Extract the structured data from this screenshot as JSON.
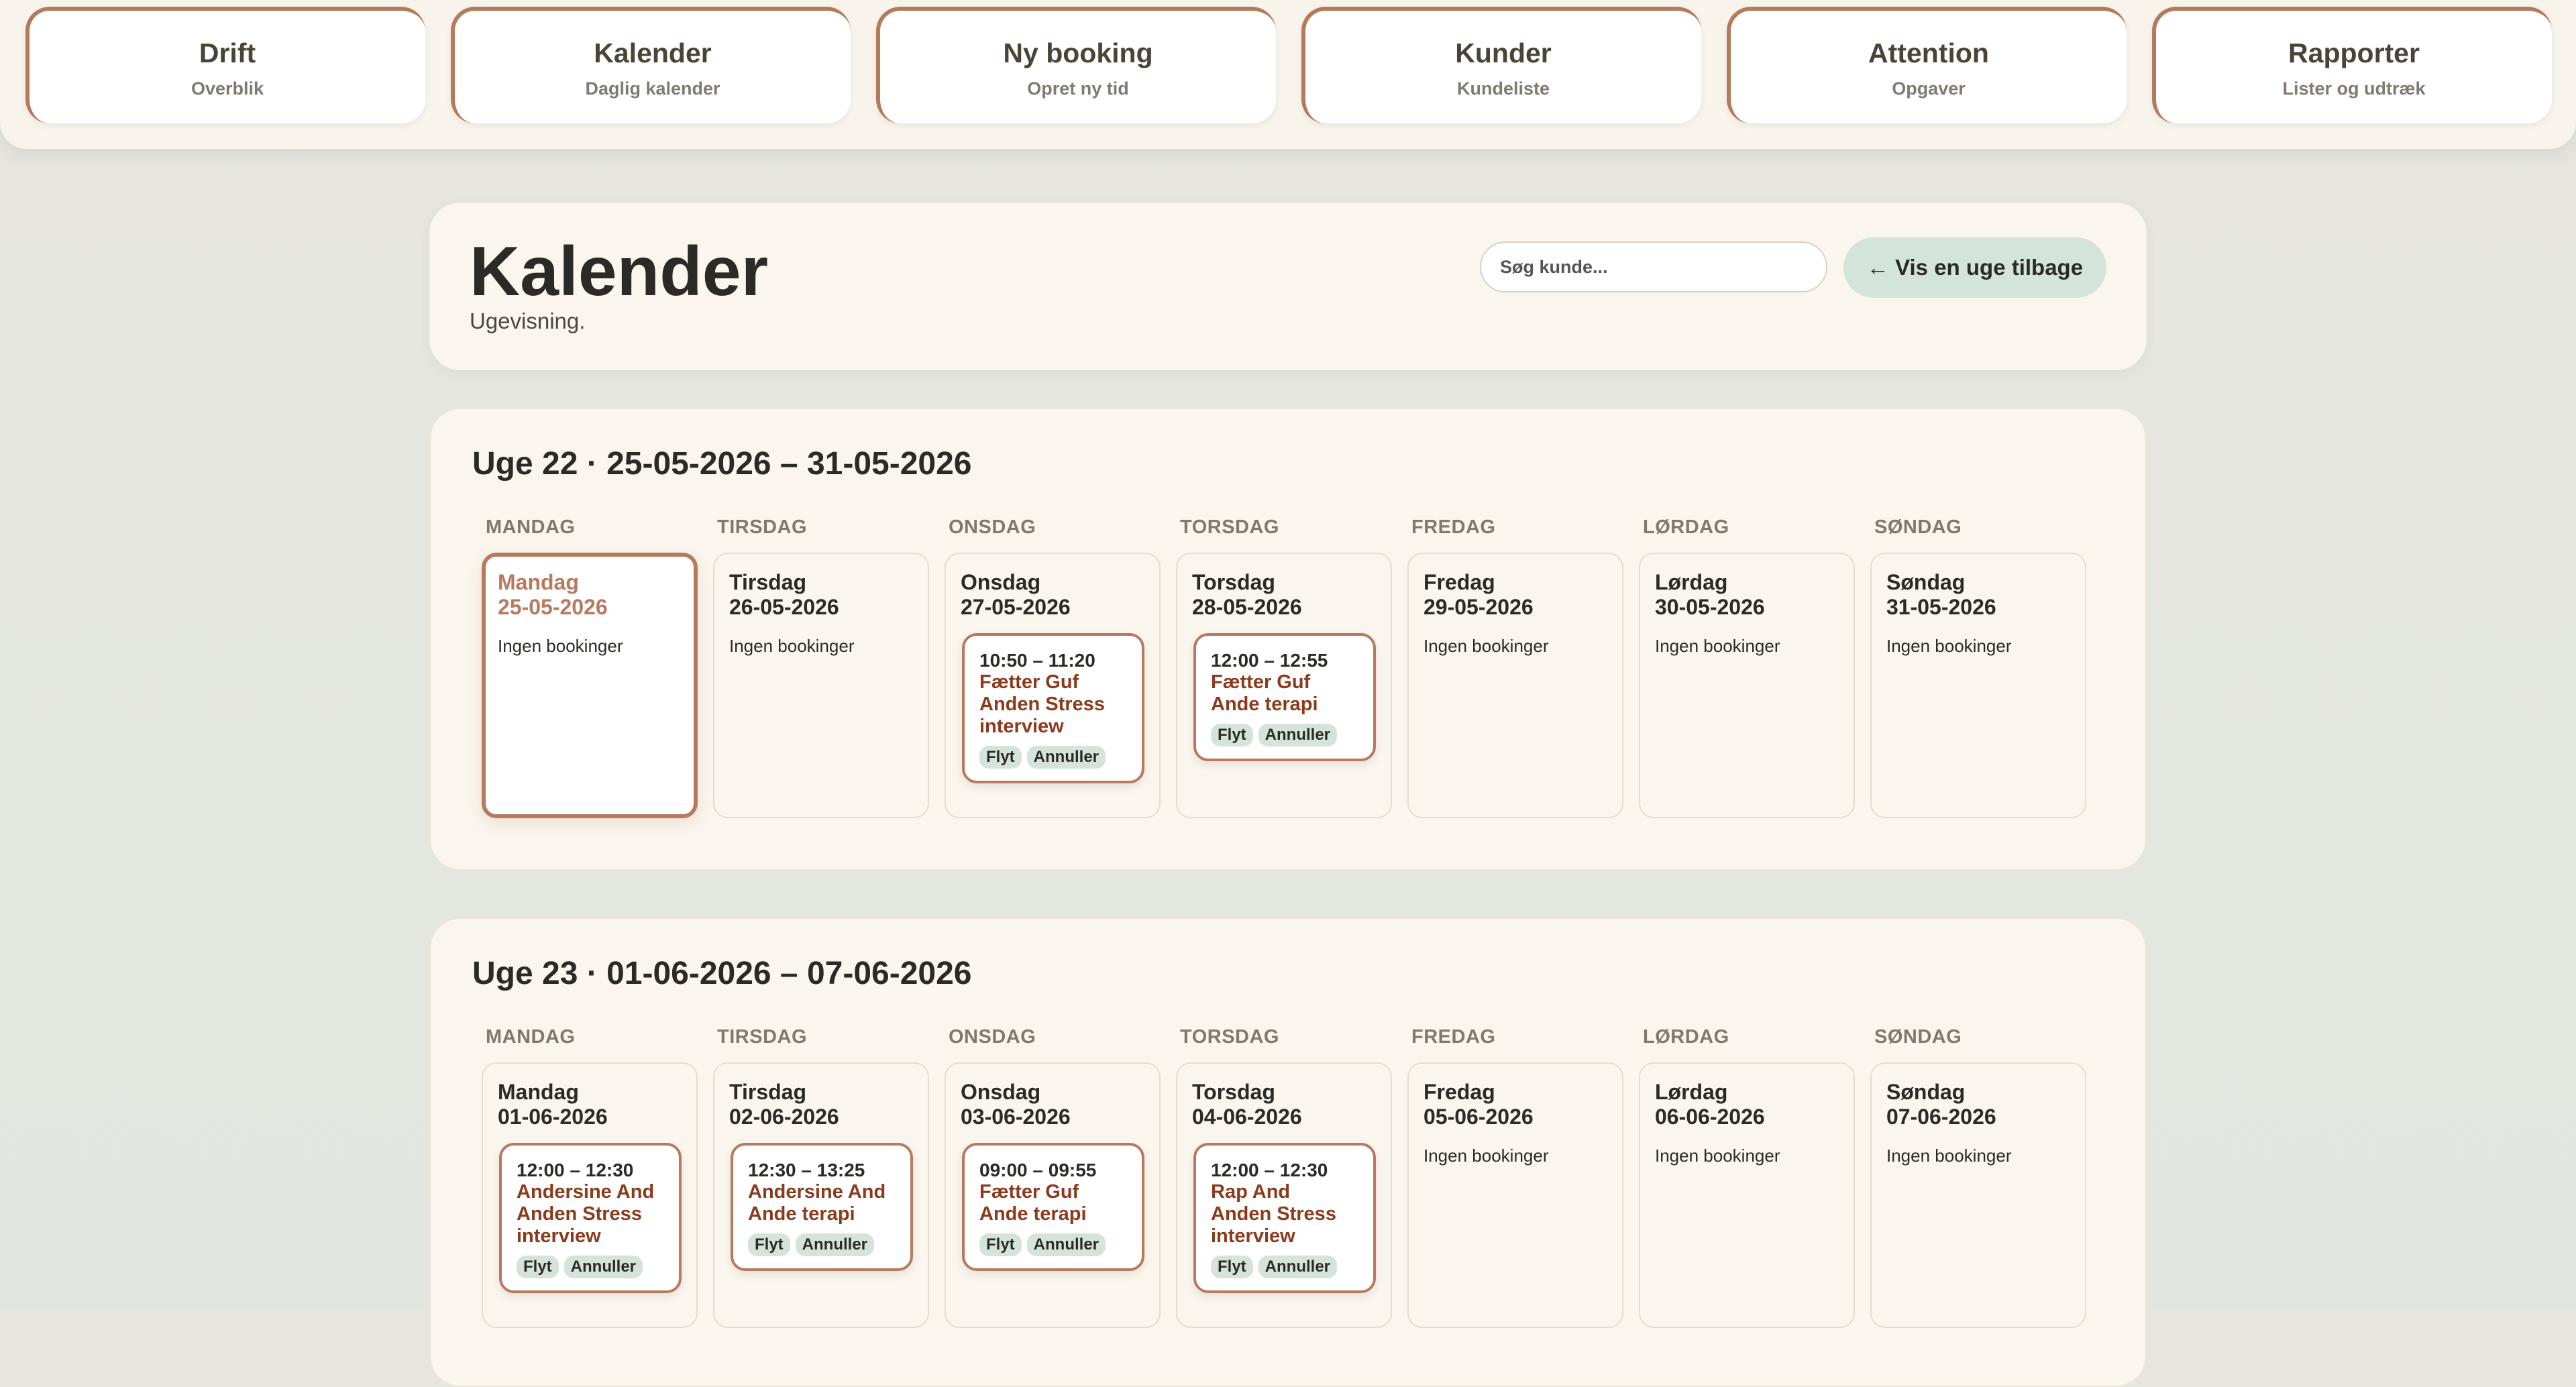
{
  "nav": [
    {
      "title": "Drift",
      "subtitle": "Overblik"
    },
    {
      "title": "Kalender",
      "subtitle": "Daglig kalender"
    },
    {
      "title": "Ny booking",
      "subtitle": "Opret ny tid"
    },
    {
      "title": "Kunder",
      "subtitle": "Kundeliste"
    },
    {
      "title": "Attention",
      "subtitle": "Opgaver"
    },
    {
      "title": "Rapporter",
      "subtitle": "Lister og udtræk"
    }
  ],
  "header": {
    "title": "Kalender",
    "subtitle": "Ugevisning.",
    "search_placeholder": "Søg kunde...",
    "back_label": "← Vis en uge tilbage"
  },
  "labels": {
    "no_bookings": "Ingen bookinger",
    "move": "Flyt",
    "cancel": "Annuller"
  },
  "weekdays": [
    "MANDAG",
    "TIRSDAG",
    "ONSDAG",
    "TORSDAG",
    "FREDAG",
    "LØRDAG",
    "SØNDAG"
  ],
  "weeks": [
    {
      "title": "Uge 22 · 25-05-2026 – 31-05-2026",
      "days": [
        {
          "name": "Mandag",
          "date": "25-05-2026",
          "today": true,
          "bookings": []
        },
        {
          "name": "Tirsdag",
          "date": "26-05-2026",
          "bookings": []
        },
        {
          "name": "Onsdag",
          "date": "27-05-2026",
          "bookings": [
            {
              "time": "10:50 – 11:20",
              "customer": "Fætter Guf",
              "treatment": "Anden Stress interview"
            }
          ]
        },
        {
          "name": "Torsdag",
          "date": "28-05-2026",
          "bookings": [
            {
              "time": "12:00 – 12:55",
              "customer": "Fætter Guf",
              "treatment": "Ande terapi"
            }
          ]
        },
        {
          "name": "Fredag",
          "date": "29-05-2026",
          "bookings": []
        },
        {
          "name": "Lørdag",
          "date": "30-05-2026",
          "bookings": []
        },
        {
          "name": "Søndag",
          "date": "31-05-2026",
          "bookings": []
        }
      ]
    },
    {
      "title": "Uge 23 · 01-06-2026 – 07-06-2026",
      "days": [
        {
          "name": "Mandag",
          "date": "01-06-2026",
          "bookings": [
            {
              "time": "12:00 – 12:30",
              "customer": "Andersine And",
              "treatment": "Anden Stress interview"
            }
          ]
        },
        {
          "name": "Tirsdag",
          "date": "02-06-2026",
          "bookings": [
            {
              "time": "12:30 – 13:25",
              "customer": "Andersine And",
              "treatment": "Ande terapi"
            }
          ]
        },
        {
          "name": "Onsdag",
          "date": "03-06-2026",
          "bookings": [
            {
              "time": "09:00 – 09:55",
              "customer": "Fætter Guf",
              "treatment": "Ande terapi"
            }
          ]
        },
        {
          "name": "Torsdag",
          "date": "04-06-2026",
          "bookings": [
            {
              "time": "12:00 – 12:30",
              "customer": "Rap And",
              "treatment": "Anden Stress interview"
            }
          ]
        },
        {
          "name": "Fredag",
          "date": "05-06-2026",
          "bookings": []
        },
        {
          "name": "Lørdag",
          "date": "06-06-2026",
          "bookings": []
        },
        {
          "name": "Søndag",
          "date": "07-06-2026",
          "bookings": []
        }
      ]
    }
  ]
}
